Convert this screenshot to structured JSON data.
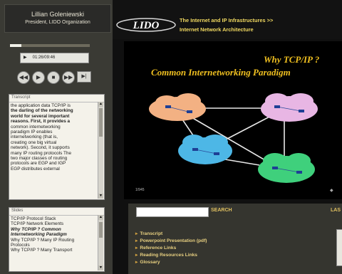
{
  "speaker": {
    "name": "Lillian Goleniewski",
    "role": "President, LIDO Organization"
  },
  "player": {
    "time": "01:26/09:46",
    "progress": 0.14,
    "end_label": "▶|"
  },
  "transcript": {
    "header": "Transcript",
    "lines": [
      "the application data TCP/IP is",
      "the darling of the networking",
      "world for several important",
      "reasons. First, it provides a",
      "common internetworking",
      "paradigm IP enables",
      "internetworking (that is,",
      "creating one big virtual",
      "network). Second, it supports",
      "many IP routing protocols The",
      "two major classes of routing",
      "protocols are EGP and IGP",
      "EGP distributes external"
    ]
  },
  "index": {
    "header": "Slides",
    "items": [
      "TCP/IP Protocol Stack",
      "TCP/IP Network Elements",
      "Why TCP/IP ? Common",
      "Internetworking Paradigm",
      "Why TCP/IP ? Many IP Routing",
      "Protocols",
      "Why TCP/IP ? Many Transport"
    ]
  },
  "header": {
    "logo_text": "LIDO",
    "crumb_line1": "The Internet and IP Infrastructures >>",
    "crumb_line2": "Internet Network Architecture"
  },
  "slide": {
    "title_line1": "Why TCP/IP ?",
    "title_line2": "Common Internetworking Paradigm",
    "number": "1/945",
    "colors": {
      "orange": "#f3b183",
      "pink": "#e8b6e4",
      "blue": "#4db7e6",
      "green": "#3fd07c"
    }
  },
  "search": {
    "placeholder": "",
    "button": "SEARCH",
    "lang": "LAS"
  },
  "links": [
    "Transcript",
    "Powerpoint Presentation (pdf)",
    "Reference Links",
    "Reading Resources Links",
    "Glossary"
  ]
}
